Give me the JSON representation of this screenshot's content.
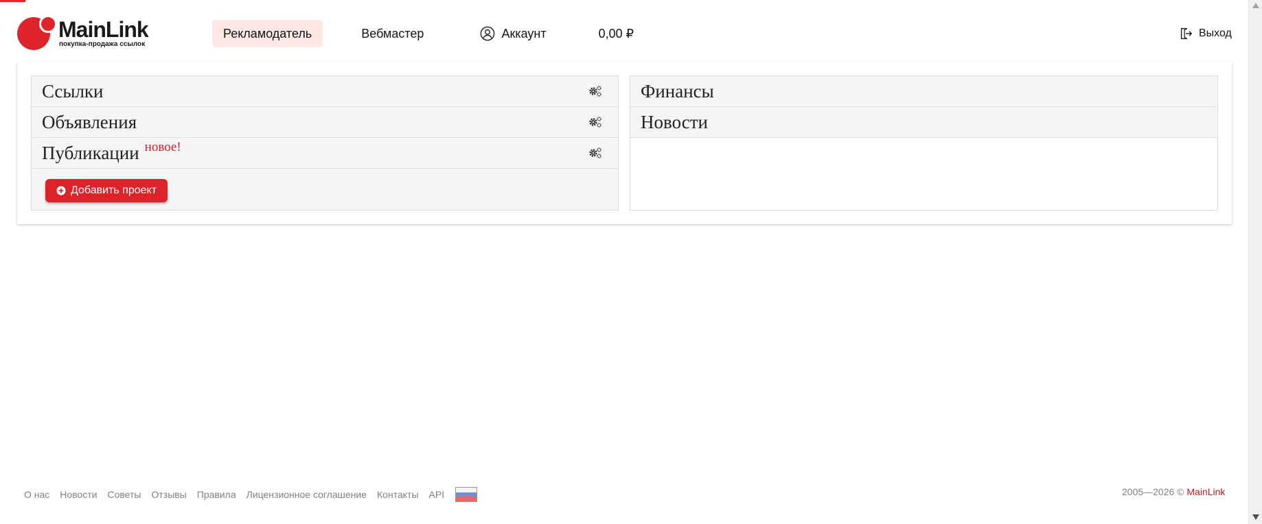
{
  "colors": {
    "brand_red": "#e0242c",
    "nav_active_bg": "#fde8e6",
    "button_red": "#dc2329",
    "new_badge": "#c8232c",
    "footer_text": "#808080"
  },
  "header": {
    "logo": {
      "name": "MainLink",
      "tagline": "покупка-продажа ссылок"
    },
    "nav": [
      {
        "label": "Рекламодатель",
        "active": true
      },
      {
        "label": "Вебмастер",
        "active": false
      },
      {
        "label": "Аккаунт",
        "icon": "user-circle-icon",
        "active": false
      },
      {
        "label": "0,00 ₽",
        "active": false
      }
    ],
    "logout": {
      "label": "Выход",
      "icon": "logout-icon"
    }
  },
  "left_panel": {
    "rows": [
      {
        "title": "Ссылки",
        "icon": "gears-icon"
      },
      {
        "title": "Объявления",
        "icon": "gears-icon"
      },
      {
        "title": "Публикации",
        "badge": "новое!",
        "icon": "gears-icon"
      }
    ],
    "add_button": {
      "label": "Добавить проект",
      "icon": "plus-circle-icon"
    }
  },
  "right_panel": {
    "rows": [
      {
        "title": "Финансы"
      },
      {
        "title": "Новости"
      }
    ]
  },
  "footer": {
    "links": [
      "О нас",
      "Новости",
      "Советы",
      "Отзывы",
      "Правила",
      "Лицензионное соглашение",
      "Контакты",
      "API"
    ],
    "language_flag": "russia-flag-icon",
    "copyright_years": "2005—2026 ©",
    "copyright_brand": "MainLink"
  }
}
